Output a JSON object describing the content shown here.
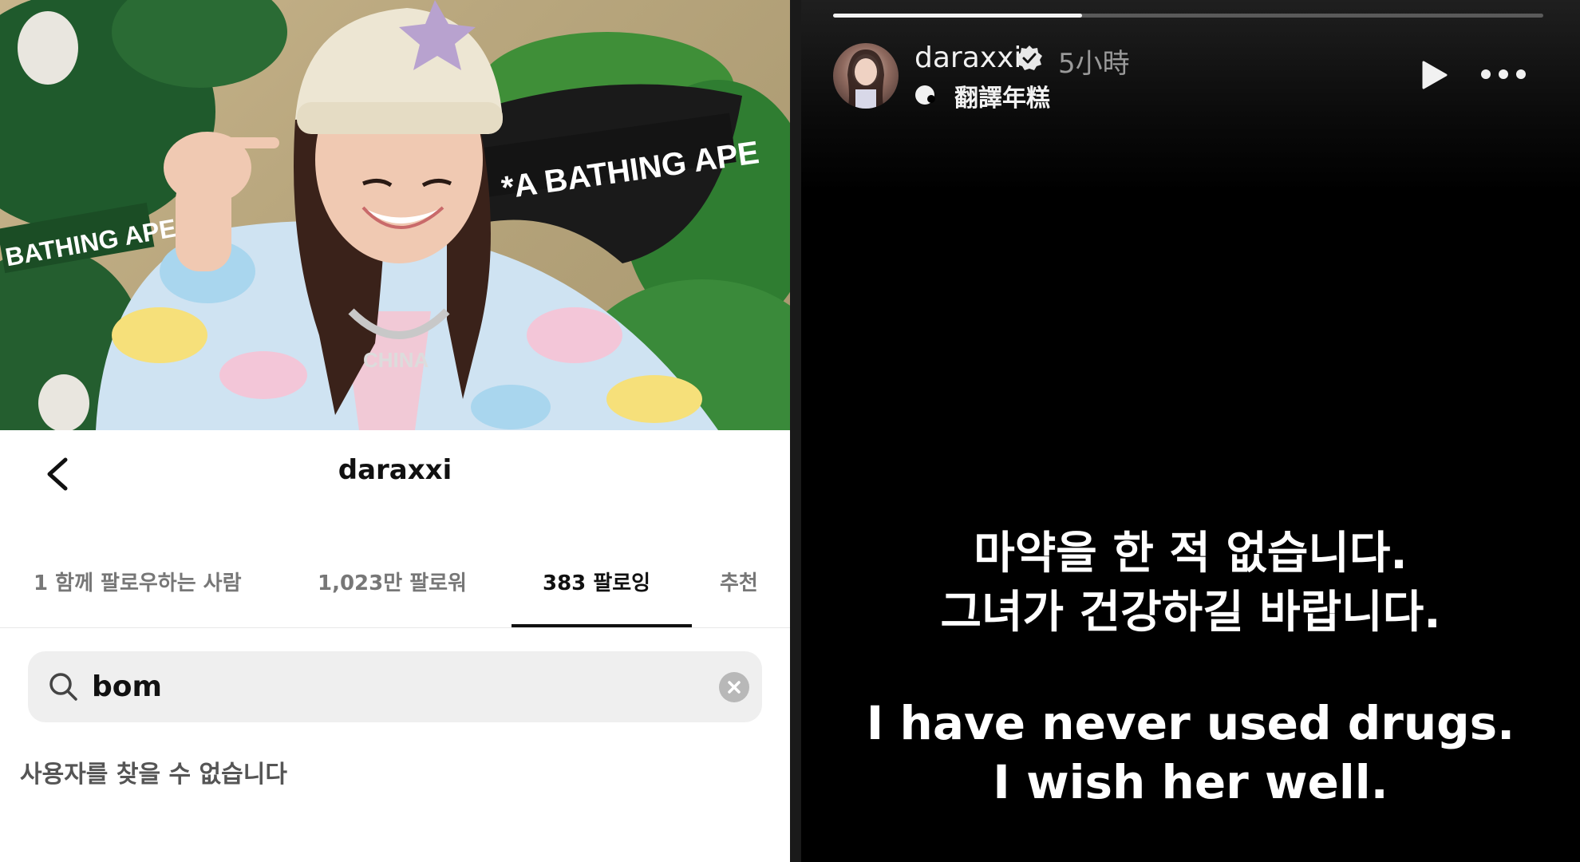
{
  "profile": {
    "username": "daraxxi",
    "photo_banner_text": "*A BATHING APE",
    "photo_left_banner_text": "BATHING APE",
    "photo_necklace_text": "CHINA",
    "tabs": [
      {
        "label": "1 함께 팔로우하는 사람",
        "active": false
      },
      {
        "label": "1,023만 팔로워",
        "active": false
      },
      {
        "label": "383 팔로잉",
        "active": true
      },
      {
        "label": "추천",
        "active": false
      }
    ],
    "search": {
      "value": "bom"
    },
    "no_result_text": "사용자를 찾을 수 없습니다"
  },
  "story": {
    "username": "daraxxi",
    "verified": true,
    "time": "5小時",
    "music_label": "翻譯年糕",
    "progress_fraction": 0.35,
    "korean_lines": [
      "마약을 한 적 없습니다.",
      "그녀가 건강하길 바랍니다."
    ],
    "english_lines": [
      "I have never used drugs.",
      "I wish her well."
    ]
  },
  "colors": {
    "story_background": "#000000",
    "profile_background": "#ffffff",
    "active_tab_underline": "#111111",
    "search_background": "#efefef"
  },
  "icons": [
    "back-arrow-icon",
    "search-icon",
    "clear-icon",
    "verified-icon",
    "music-icon",
    "play-icon",
    "more-icon"
  ]
}
